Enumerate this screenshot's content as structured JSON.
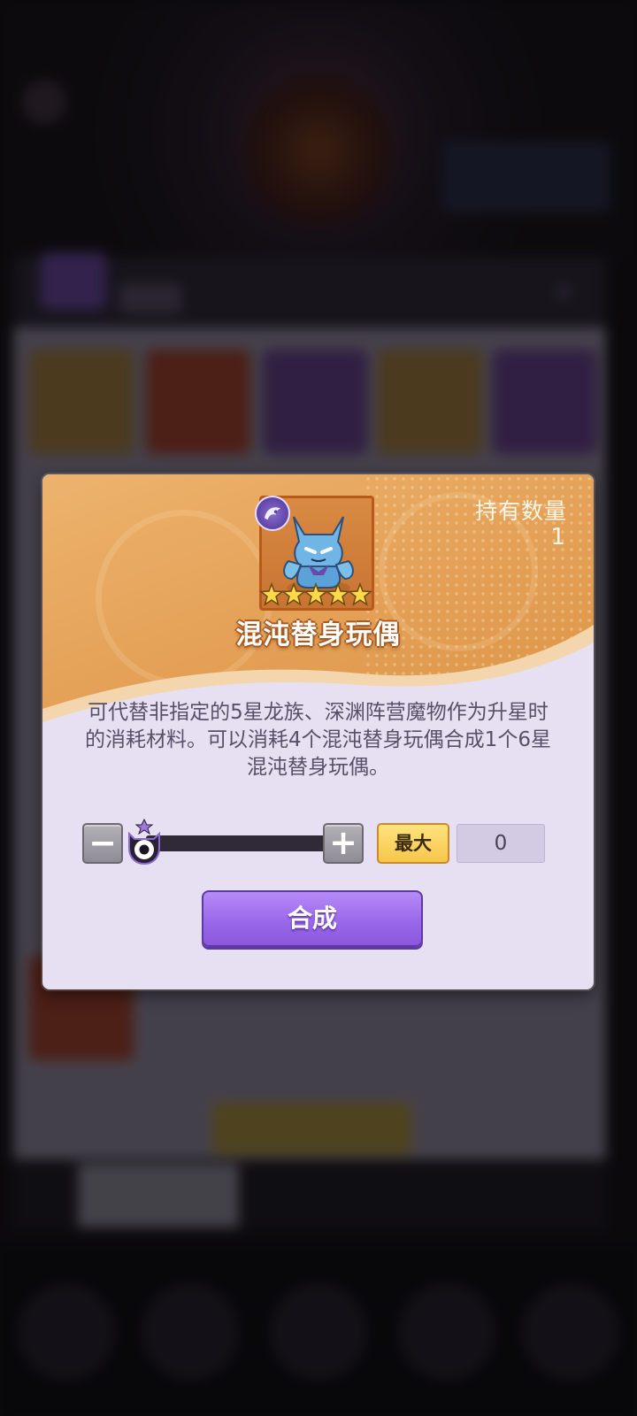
{
  "dialog": {
    "held_quantity_label": "持有数量",
    "held_quantity_value": "1",
    "item_name": "混沌替身玩偶",
    "item_stars": 5,
    "description": "可代替非指定的5星龙族、深渊阵营魔物作为升星时的消耗材料。可以消耗4个混沌替身玩偶合成1个6星混沌替身玩偶。",
    "stepper": {
      "minus_label": "−",
      "plus_label": "+",
      "max_label": "最大",
      "amount": "0",
      "slider_fraction": 0
    },
    "compose_label": "合成"
  },
  "colors": {
    "header_orange": "#e4a157",
    "dialog_lavender": "#e6e0f2",
    "compose_purple": "#9a68ea",
    "max_yellow": "#f7c64a"
  },
  "icons": {
    "faction": "abyss-faction-icon",
    "item": "chaos-doll-icon",
    "star": "star-icon",
    "slider_knob": "eye-monster-knob-icon"
  }
}
